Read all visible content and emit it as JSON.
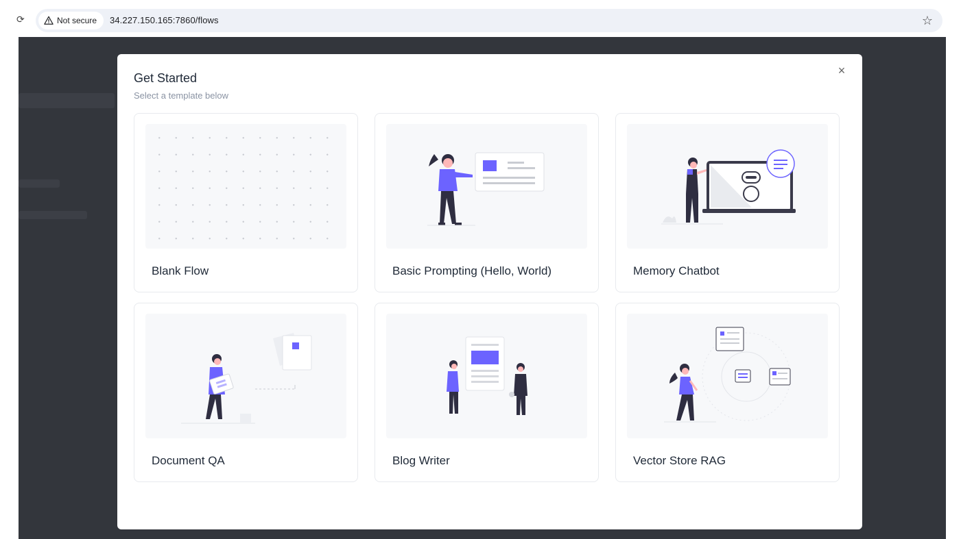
{
  "browser": {
    "security_label": "Not secure",
    "url": "34.227.150.165:7860/flows"
  },
  "modal": {
    "title": "Get Started",
    "subtitle": "Select a template below",
    "close_glyph": "×"
  },
  "templates": [
    {
      "label": "Blank Flow",
      "icon": "dot-grid"
    },
    {
      "label": "Basic Prompting (Hello, World)",
      "icon": "person-presenting-board"
    },
    {
      "label": "Memory Chatbot",
      "icon": "person-with-chatbot-laptop"
    },
    {
      "label": "Document QA",
      "icon": "person-with-documents"
    },
    {
      "label": "Blog Writer",
      "icon": "people-with-article"
    },
    {
      "label": "Vector Store RAG",
      "icon": "person-with-vector-nodes"
    }
  ],
  "colors": {
    "accent": "#6c63ff",
    "overlay": "#33363c",
    "figure_dark": "#2f2e41",
    "skin": "#ffb8b8"
  }
}
